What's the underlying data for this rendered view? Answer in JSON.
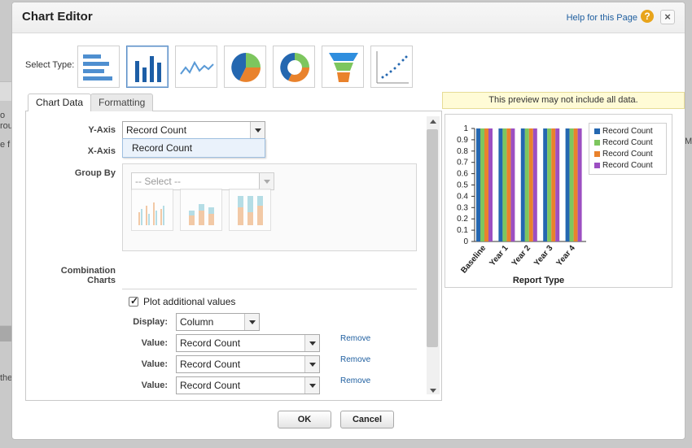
{
  "background": {
    "snippets": [
      "o",
      "rou",
      "e f",
      "the"
    ],
    "right_snippet": "M"
  },
  "dialog": {
    "title": "Chart Editor",
    "help_link": "Help for this Page",
    "help_icon": "help-icon",
    "close_symbol": "×"
  },
  "select_type": {
    "label": "Select Type:",
    "types": [
      {
        "name": "horizontal-bar",
        "selected": false
      },
      {
        "name": "vertical-column",
        "selected": true
      },
      {
        "name": "line",
        "selected": false
      },
      {
        "name": "pie",
        "selected": false
      },
      {
        "name": "donut",
        "selected": false
      },
      {
        "name": "funnel",
        "selected": false
      },
      {
        "name": "scatter",
        "selected": false
      }
    ]
  },
  "tabs": [
    {
      "label": "Chart Data",
      "active": true
    },
    {
      "label": "Formatting",
      "active": false
    }
  ],
  "chart_data_panel": {
    "y_axis_label": "Y-Axis",
    "y_axis_value": "Record Count",
    "y_axis_dropdown_option": "Record Count",
    "x_axis_label": "X-Axis",
    "group_by_label": "Group By",
    "group_by_placeholder": "-- Select --",
    "combination_charts_label_1": "Combination",
    "combination_charts_label_2": "Charts",
    "plot_additional_label": "Plot additional values",
    "plot_additional_checked": true,
    "display_label": "Display:",
    "display_value": "Column",
    "value_label": "Value:",
    "values": [
      "Record Count",
      "Record Count",
      "Record Count"
    ],
    "remove_label": "Remove"
  },
  "preview": {
    "note": "This preview may not include all data."
  },
  "chart_data": {
    "type": "bar",
    "categories": [
      "Baseline",
      "Year 1",
      "Year 2",
      "Year 3",
      "Year 4"
    ],
    "series": [
      {
        "name": "Record Count",
        "values": [
          1,
          1,
          1,
          1,
          1
        ],
        "color": "#2467b0"
      },
      {
        "name": "Record Count",
        "values": [
          1,
          1,
          1,
          1,
          1
        ],
        "color": "#7dc65e"
      },
      {
        "name": "Record Count",
        "values": [
          1,
          1,
          1,
          1,
          1
        ],
        "color": "#e9822c"
      },
      {
        "name": "Record Count",
        "values": [
          1,
          1,
          1,
          1,
          1
        ],
        "color": "#9c4fc2"
      }
    ],
    "y_ticks": [
      "0",
      "0.1",
      "0.2",
      "0.3",
      "0.4",
      "0.5",
      "0.6",
      "0.7",
      "0.8",
      "0.9",
      "1"
    ],
    "ylim": [
      0,
      1
    ],
    "xlabel": "Report Type",
    "ylabel": "",
    "legend_position": "top-right"
  },
  "buttons": {
    "ok": "OK",
    "cancel": "Cancel"
  }
}
